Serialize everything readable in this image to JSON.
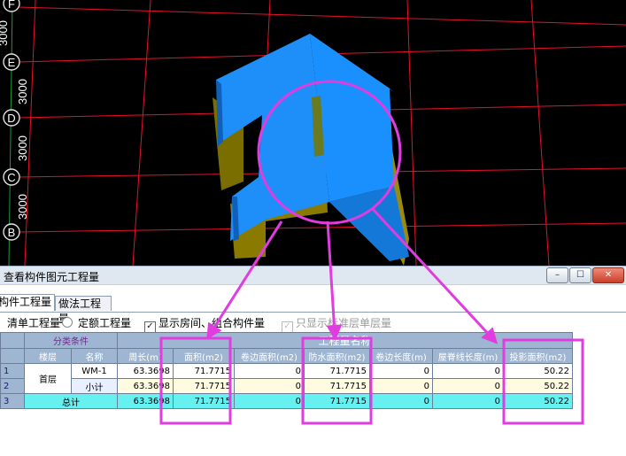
{
  "viewport": {
    "axis_labels": [
      "F",
      "E",
      "D",
      "C",
      "B"
    ],
    "dim_labels": [
      "3000",
      "3000",
      "3000",
      "3000"
    ]
  },
  "window": {
    "title": "查看构件图元工程量",
    "controls": {
      "minimize": "–",
      "maximize": "☐",
      "close": "✕"
    }
  },
  "tabs": [
    {
      "label": "构件工程量",
      "active": true
    },
    {
      "label": "做法工程量",
      "active": false
    }
  ],
  "toolbar": {
    "qingdan": "清单工程量",
    "dinge": "定额工程量",
    "show_rooms": "显示房间、组合构件量",
    "only_layer": "只显示标准层单层量"
  },
  "table": {
    "group_category": "分类条件",
    "group_quantity": "工程量名称",
    "col_floor": "楼层",
    "col_name": "名称",
    "columns": [
      "周长(m)",
      "面积(m2)",
      "卷边面积(m2)",
      "防水面积(m2)",
      "卷边长度(m)",
      "屋脊线长度(m)",
      "投影面积(m2)"
    ],
    "rows": [
      {
        "no": "1",
        "floor": "首层",
        "name": "WM-1",
        "values": [
          "63.3698",
          "71.7715",
          "0",
          "71.7715",
          "0",
          "0",
          "50.22"
        ]
      },
      {
        "no": "2",
        "floor": "",
        "name": "小计",
        "values": [
          "63.3698",
          "71.7715",
          "0",
          "71.7715",
          "0",
          "0",
          "50.22"
        ]
      },
      {
        "no": "3",
        "floor": "",
        "name": "总计",
        "values": [
          "63.3698",
          "71.7715",
          "0",
          "71.7715",
          "0",
          "0",
          "50.22"
        ]
      }
    ]
  },
  "colors": {
    "grid_line": "#e8102a",
    "axis": "#1a9a3a",
    "roof_blue": "#1a90ff",
    "wall_olive": "#8a7a00",
    "annotation": "#e03ce0"
  }
}
